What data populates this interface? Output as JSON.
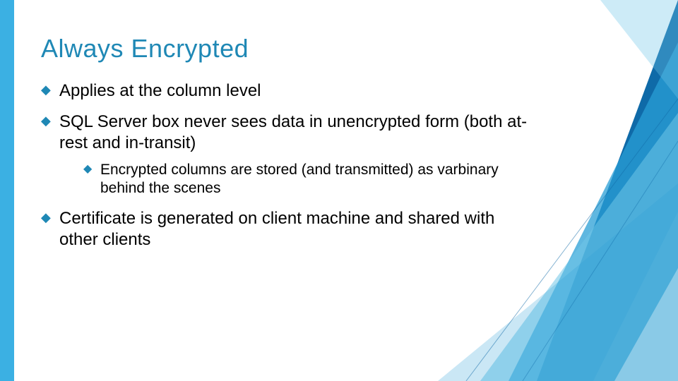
{
  "title": "Always Encrypted",
  "bullets": [
    {
      "text": "Applies at the column level"
    },
    {
      "text": "SQL Server box never sees data in unencrypted form (both at-rest and in-transit)",
      "sub": [
        {
          "text": "Encrypted columns are stored (and transmitted) as varbinary behind the scenes"
        }
      ]
    },
    {
      "text": "Certificate is generated on client machine and shared with other clients"
    }
  ],
  "colors": {
    "accent": "#1f88b5",
    "leftbar": "#3bb0e3"
  }
}
